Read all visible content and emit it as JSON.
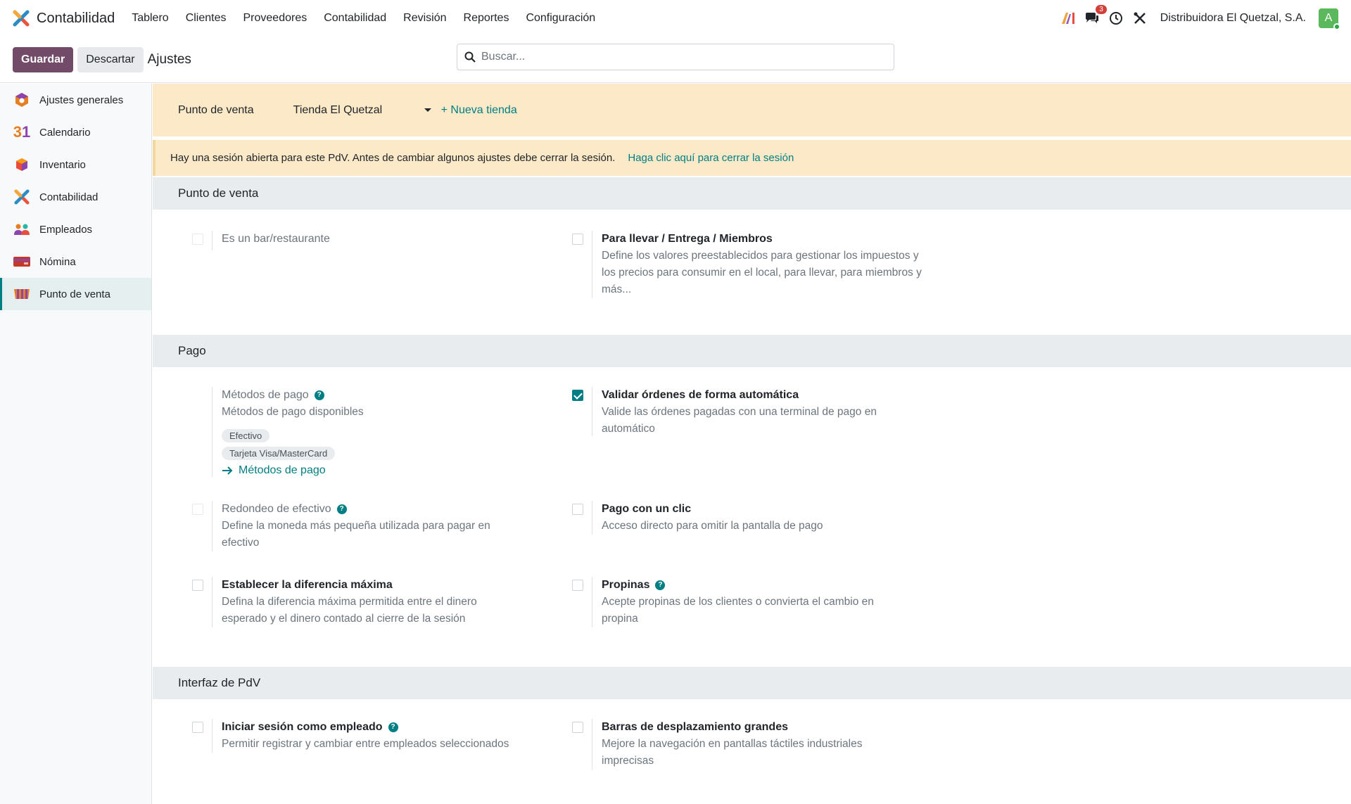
{
  "app": {
    "name": "Contabilidad",
    "menu": [
      "Tablero",
      "Clientes",
      "Proveedores",
      "Contabilidad",
      "Revisión",
      "Reportes",
      "Configuración"
    ],
    "messages_count": "3",
    "company": "Distribuidora El Quetzal, S.A.",
    "avatar_letter": "A"
  },
  "toolbar": {
    "save_label": "Guardar",
    "discard_label": "Descartar",
    "page_title": "Ajustes",
    "search_placeholder": "Buscar..."
  },
  "sidebar": {
    "items": [
      {
        "label": "Ajustes generales",
        "icon": "settings-icon"
      },
      {
        "label": "Calendario",
        "icon": "calendar-icon"
      },
      {
        "label": "Inventario",
        "icon": "inventory-icon"
      },
      {
        "label": "Contabilidad",
        "icon": "accounting-icon"
      },
      {
        "label": "Empleados",
        "icon": "employees-icon"
      },
      {
        "label": "Nómina",
        "icon": "payroll-icon"
      },
      {
        "label": "Punto de venta",
        "icon": "pos-icon"
      }
    ],
    "calendar_number": "31"
  },
  "store_bar": {
    "label": "Punto de venta",
    "selected_store": "Tienda El Quetzal",
    "new_store": "+ Nueva tienda"
  },
  "alert": {
    "text": "Hay una sesión abierta para este PdV. Antes de cambiar algunos ajustes debe cerrar la sesión.",
    "link": "Haga clic aquí para cerrar la sesión"
  },
  "sections": {
    "pos": {
      "title": "Punto de venta",
      "bar_restaurant": "Es un bar/restaurante",
      "takeaway_title": "Para llevar / Entrega / Miembros",
      "takeaway_desc": "Define los valores preestablecidos para gestionar los impuestos y los precios para consumir en el local, para llevar, para miembros y más..."
    },
    "payment": {
      "title": "Pago",
      "methods_title": "Métodos de pago",
      "methods_desc": "Métodos de pago disponibles",
      "methods_tags": [
        "Efectivo",
        "Tarjeta Visa/MasterCard"
      ],
      "methods_link": "Métodos de pago",
      "auto_validate_title": "Validar órdenes de forma automática",
      "auto_validate_desc": "Valide las órdenes pagadas con una terminal de pago en automático",
      "rounding_title": "Redondeo de efectivo",
      "rounding_desc": "Define la moneda más pequeña utilizada para pagar en efectivo",
      "one_click_title": "Pago con un clic",
      "one_click_desc": "Acceso directo para omitir la pantalla de pago",
      "max_diff_title": "Establecer la diferencia máxima",
      "max_diff_desc": "Defina la diferencia máxima permitida entre el dinero esperado y el dinero contado al cierre de la sesión",
      "tips_title": "Propinas",
      "tips_desc": "Acepte propinas de los clientes o convierta el cambio en propina"
    },
    "interface": {
      "title": "Interfaz de PdV",
      "employee_login_title": "Iniciar sesión como empleado",
      "employee_login_desc": "Permitir registrar y cambiar entre empleados seleccionados",
      "large_scroll_title": "Barras de desplazamiento grandes",
      "large_scroll_desc": "Mejore la navegación en pantallas táctiles industriales imprecisas"
    }
  },
  "colors": {
    "primary": "#714b67",
    "accent": "#017e84",
    "warning_bg": "#fbe9c7"
  }
}
